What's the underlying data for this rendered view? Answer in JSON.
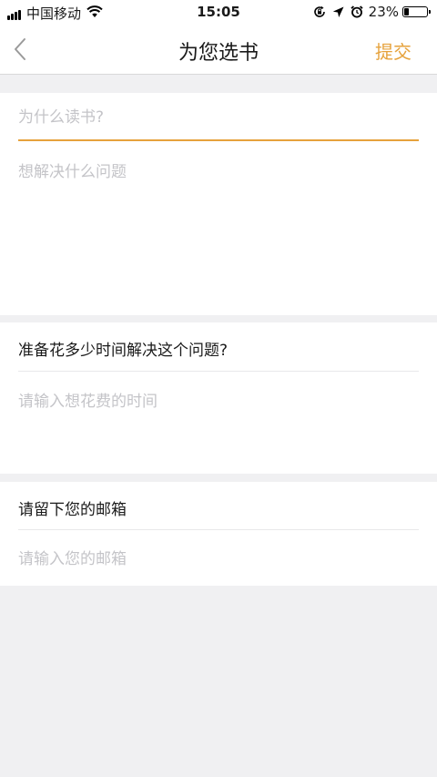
{
  "status_bar": {
    "carrier": "中国移动",
    "time": "15:05",
    "battery_percent": "23%",
    "battery_level": 0.23,
    "icons": [
      "signal-icon",
      "wifi-icon",
      "rotation-lock-icon",
      "location-arrow-icon",
      "alarm-icon",
      "battery-icon"
    ]
  },
  "nav": {
    "title": "为您选书",
    "submit_label": "提交",
    "back_icon": "chevron-left-icon"
  },
  "form": {
    "reason": {
      "placeholder": "为什么读书?",
      "value": ""
    },
    "problem": {
      "placeholder": "想解决什么问题",
      "value": ""
    },
    "time_question": {
      "label": "准备花多少时间解决这个问题?",
      "placeholder": "请输入想花费的时间",
      "value": ""
    },
    "email_question": {
      "label": "请留下您的邮箱",
      "placeholder": "请输入您的邮箱",
      "value": ""
    }
  },
  "colors": {
    "accent": "#e6a23c",
    "background": "#f0f0f2",
    "placeholder": "#c4c4c8"
  }
}
